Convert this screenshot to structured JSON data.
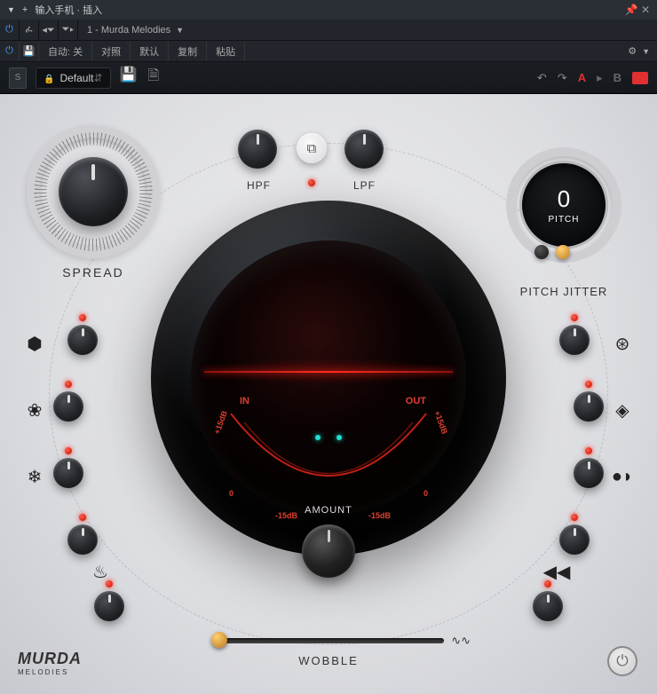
{
  "titlebar": {
    "title": "输入手机 · 插入"
  },
  "preset": {
    "name": "1 - Murda Melodies",
    "default": "Default"
  },
  "tb2": {
    "auto": "自动:",
    "off": "关",
    "compare": "对照",
    "default": "默认",
    "copy": "复制",
    "paste": "粘贴"
  },
  "ab": {
    "a": "A",
    "b": "B"
  },
  "filters": {
    "hpf": "HPF",
    "lpf": "LPF"
  },
  "spread": {
    "label": "SPREAD"
  },
  "pitch": {
    "value": "0",
    "label": "PITCH",
    "section": "PITCH JITTER"
  },
  "dial": {
    "in": "IN",
    "out": "OUT",
    "plus": "+15dB",
    "zero": "0",
    "minus": "-15dB",
    "amount": "AMOUNT"
  },
  "wobble": {
    "label": "WOBBLE"
  },
  "brand": {
    "main": "MURDA",
    "sub": "MELODIES"
  },
  "left_fx": [
    {
      "icon": "cube-icon",
      "glyph": "⬢"
    },
    {
      "icon": "flower-icon",
      "glyph": "❀"
    },
    {
      "icon": "snowflake-icon",
      "glyph": "❄"
    },
    {
      "icon": "flame-icon",
      "glyph": "🔥"
    },
    {
      "icon": "flame2-icon",
      "glyph": ""
    }
  ],
  "right_fx": [
    {
      "icon": "rings-icon",
      "glyph": "⊛"
    },
    {
      "icon": "diamond-icon",
      "glyph": "◈"
    },
    {
      "icon": "dots-icon",
      "glyph": "◗•"
    },
    {
      "icon": "rewind-icon",
      "glyph": "◀◀"
    },
    {
      "icon": "rewind2-icon",
      "glyph": ""
    }
  ]
}
